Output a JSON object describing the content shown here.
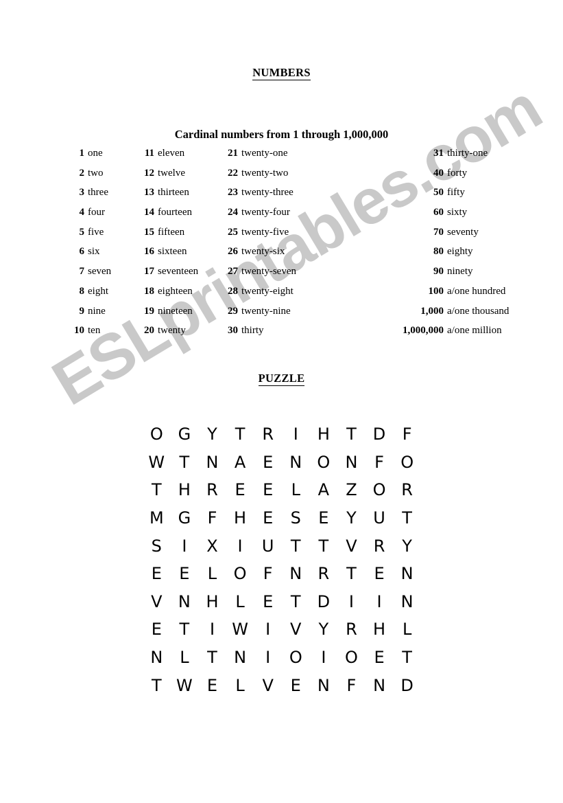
{
  "document": {
    "title": "NUMBERS",
    "subtitle": "Cardinal numbers from 1 through 1,000,000",
    "puzzle_heading": "PUZZLE"
  },
  "watermark": {
    "text": "ESLprintables.com",
    "color": "#c9c9c9"
  },
  "numbers": {
    "columns": [
      [
        {
          "n": "1",
          "w": "one"
        },
        {
          "n": "2",
          "w": "two"
        },
        {
          "n": "3",
          "w": "three"
        },
        {
          "n": "4",
          "w": "four"
        },
        {
          "n": "5",
          "w": "five"
        },
        {
          "n": "6",
          "w": "six"
        },
        {
          "n": "7",
          "w": "seven"
        },
        {
          "n": "8",
          "w": "eight"
        },
        {
          "n": "9",
          "w": "nine"
        },
        {
          "n": "10",
          "w": "ten"
        }
      ],
      [
        {
          "n": "11",
          "w": "eleven"
        },
        {
          "n": "12",
          "w": "twelve"
        },
        {
          "n": "13",
          "w": "thirteen"
        },
        {
          "n": "14",
          "w": "fourteen"
        },
        {
          "n": "15",
          "w": "fifteen"
        },
        {
          "n": "16",
          "w": "sixteen"
        },
        {
          "n": "17",
          "w": "seventeen"
        },
        {
          "n": "18",
          "w": "eighteen"
        },
        {
          "n": "19",
          "w": "nineteen"
        },
        {
          "n": "20",
          "w": "twenty"
        }
      ],
      [
        {
          "n": "21",
          "w": "twenty-one"
        },
        {
          "n": "22",
          "w": "twenty-two"
        },
        {
          "n": "23",
          "w": "twenty-three"
        },
        {
          "n": "24",
          "w": "twenty-four"
        },
        {
          "n": "25",
          "w": "twenty-five"
        },
        {
          "n": "26",
          "w": "twenty-six"
        },
        {
          "n": "27",
          "w": "twenty-seven"
        },
        {
          "n": "28",
          "w": "twenty-eight"
        },
        {
          "n": "29",
          "w": "twenty-nine"
        },
        {
          "n": "30",
          "w": "thirty"
        }
      ],
      [
        {
          "n": "31",
          "w": "thirty-one"
        },
        {
          "n": "40",
          "w": "forty"
        },
        {
          "n": "50",
          "w": "fifty"
        },
        {
          "n": "60",
          "w": "sixty"
        },
        {
          "n": "70",
          "w": "seventy"
        },
        {
          "n": "80",
          "w": "eighty"
        },
        {
          "n": "90",
          "w": "ninety"
        },
        {
          "n": "100",
          "w": "a/one hundred"
        },
        {
          "n": "1,000",
          "w": "a/one thousand"
        },
        {
          "n": "1,000,000",
          "w": "a/one million"
        }
      ]
    ]
  },
  "puzzle": {
    "rows": 10,
    "cols": 10,
    "grid": [
      [
        "O",
        "G",
        "Y",
        "T",
        "R",
        "I",
        "H",
        "T",
        "D",
        "F"
      ],
      [
        "W",
        "T",
        "N",
        "A",
        "E",
        "N",
        "O",
        "N",
        "F",
        "O"
      ],
      [
        "T",
        "H",
        "R",
        "E",
        "E",
        "L",
        "A",
        "Z",
        "O",
        "R"
      ],
      [
        "M",
        "G",
        "F",
        "H",
        "E",
        "S",
        "E",
        "Y",
        "U",
        "T"
      ],
      [
        "S",
        "I",
        "X",
        "I",
        "U",
        "T",
        "T",
        "V",
        "R",
        "Y"
      ],
      [
        "E",
        "E",
        "L",
        "O",
        "F",
        "N",
        "R",
        "T",
        "E",
        "N"
      ],
      [
        "V",
        "N",
        "H",
        "L",
        "E",
        "T",
        "D",
        "I",
        "I",
        "N"
      ],
      [
        "E",
        "T",
        "I",
        "W",
        "I",
        "V",
        "Y",
        "R",
        "H",
        "L"
      ],
      [
        "N",
        "L",
        "T",
        "N",
        "I",
        "O",
        "I",
        "O",
        "E",
        "T"
      ],
      [
        "T",
        "W",
        "E",
        "L",
        "V",
        "E",
        "N",
        "F",
        "N",
        "D"
      ]
    ]
  }
}
